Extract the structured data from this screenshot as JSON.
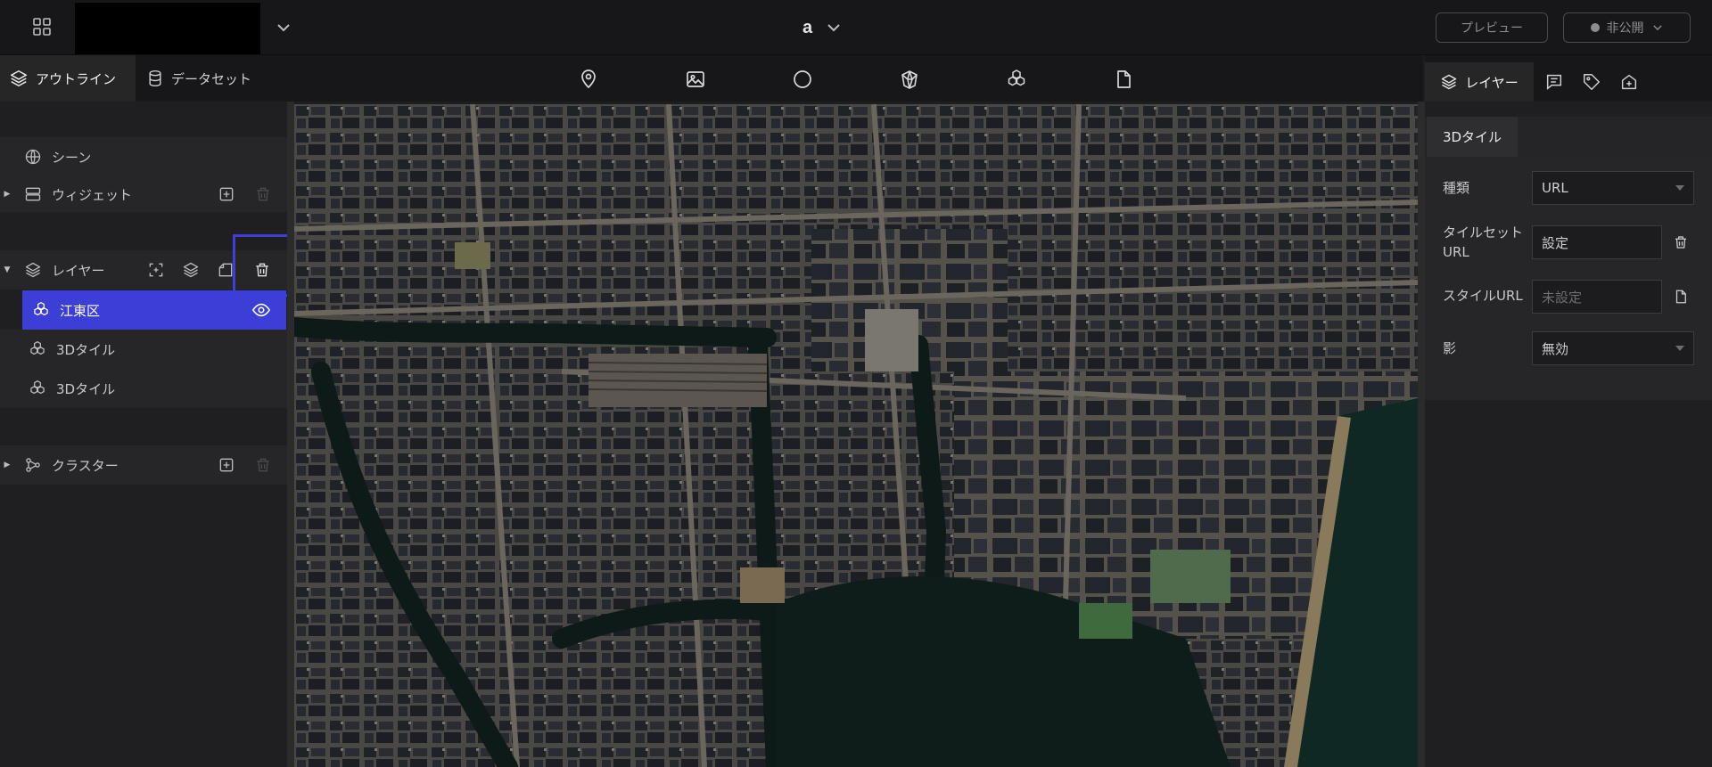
{
  "header": {
    "apps_icon": "grid-icon",
    "project_chevron_icon": "chevron-down-icon",
    "scene_title": "a",
    "preview_label": "プレビュー",
    "publish_label": "非公開"
  },
  "left_tabs": [
    {
      "label": "アウトライン",
      "icon": "layers-icon"
    },
    {
      "label": "データセット",
      "icon": "database-icon"
    }
  ],
  "outline": {
    "scene_label": "シーン",
    "widget_label": "ウィジェット",
    "layers_label": "レイヤー",
    "layer_items": [
      {
        "label": "江東区",
        "selected": true
      },
      {
        "label": "3Dタイル",
        "selected": false
      },
      {
        "label": "3Dタイル",
        "selected": false
      }
    ],
    "cluster_label": "クラスター"
  },
  "tools": [
    "marker-icon",
    "image-icon",
    "circle-icon",
    "polygon-icon",
    "3d-tiles-icon",
    "file-icon"
  ],
  "right_tabs": [
    {
      "label": "レイヤー",
      "icon": "layers-icon"
    },
    {
      "icon": "infobox-icon"
    },
    {
      "icon": "tag-icon"
    },
    {
      "icon": "export-icon"
    }
  ],
  "properties": {
    "subtab": "3Dタイル",
    "type_label": "種類",
    "type_value": "URL",
    "tileset_label_line1": "タイルセット",
    "tileset_label_line2": "URL",
    "tileset_value": "設定",
    "style_label": "スタイルURL",
    "style_placeholder": "未設定",
    "shadow_label": "影",
    "shadow_value": "無効"
  },
  "colors": {
    "accent": "#3b3fd6",
    "header_bg": "#171618",
    "panel_bg": "#1f1e20"
  }
}
